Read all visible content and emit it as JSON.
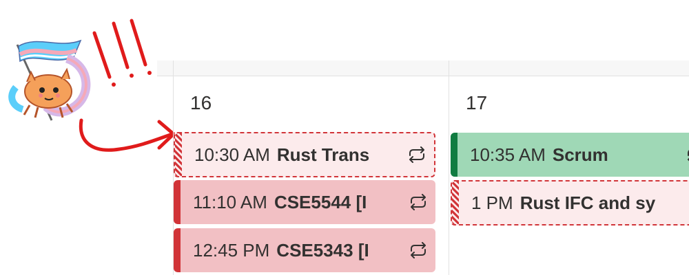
{
  "icons": {
    "repeat": "repeat-icon",
    "crab_mascot": "crab-with-flag-icon",
    "exclamation_marks": "exclamation-marks-doodle",
    "arrow": "hand-drawn-arrow"
  },
  "colors": {
    "tentative_border": "#d13438",
    "red_event_fill": "#f2c0c4",
    "red_event_bar": "#d13438",
    "green_event_fill": "#9fd8b6",
    "green_event_bar": "#107c41",
    "doodle_red": "#e01b1b",
    "crab_orange": "#f5a05a",
    "flag_blue": "#5bcefa",
    "flag_pink": "#f5a9b8"
  },
  "days": [
    {
      "day_number": "16",
      "events": [
        {
          "time": "10:30 AM",
          "title": "Rust Trans",
          "status": "tentative"
        },
        {
          "time": "11:10 AM",
          "title": "CSE5544 [I",
          "status": "busy"
        },
        {
          "time": "12:45 PM",
          "title": "CSE5343 [I",
          "status": "busy"
        }
      ]
    },
    {
      "day_number": "17",
      "events": [
        {
          "time": "10:35 AM",
          "title": "Scrum",
          "status": "busy"
        },
        {
          "time": "1 PM",
          "title": "Rust IFC and sy",
          "status": "tentative"
        }
      ]
    }
  ]
}
